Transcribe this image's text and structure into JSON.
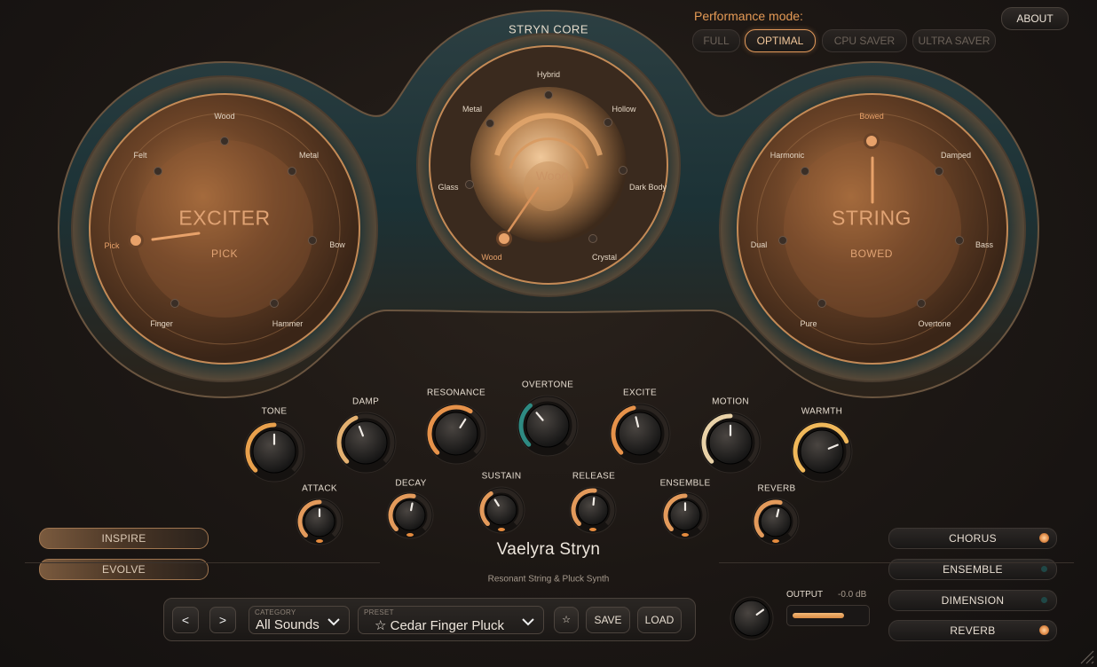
{
  "header": {
    "core_title": "STRYN CORE",
    "performance_label": "Performance mode:",
    "modes": [
      "FULL",
      "OPTIMAL",
      "CPU SAVER",
      "ULTRA SAVER"
    ],
    "active_mode": "OPTIMAL",
    "about_label": "ABOUT"
  },
  "exciter": {
    "title": "EXCITER",
    "value": "PICK",
    "options": [
      "Wood",
      "Metal",
      "Bow",
      "Hammer",
      "Finger",
      "Pick",
      "Felt"
    ],
    "selected": "Pick"
  },
  "core": {
    "options": [
      "Hybrid",
      "Hollow",
      "Dark Body",
      "Crystal",
      "Wood",
      "Glass",
      "Metal"
    ],
    "selected": "Wood",
    "center_text": "Wood"
  },
  "string": {
    "title": "STRING",
    "value": "BOWED",
    "options": [
      "Bowed",
      "Damped",
      "Bass",
      "Overtone",
      "Pure",
      "Dual",
      "Harmonic"
    ],
    "selected": "Bowed"
  },
  "knobs_main": [
    {
      "label": "TONE",
      "value": 0.5,
      "accent": "#e8a04c"
    },
    {
      "label": "DAMP",
      "value": 0.42,
      "accent": "#e3b070"
    },
    {
      "label": "RESONANCE",
      "value": 0.62,
      "accent": "#e6924a"
    },
    {
      "label": "OVERTONE",
      "value": 0.35,
      "accent": "#2e8a82"
    },
    {
      "label": "EXCITE",
      "value": 0.45,
      "accent": "#e6924a"
    },
    {
      "label": "MOTION",
      "value": 0.5,
      "accent": "#e9d2a8"
    },
    {
      "label": "WARMTH",
      "value": 0.75,
      "accent": "#f0b85a"
    }
  ],
  "knobs_small": [
    {
      "label": "ATTACK",
      "value": 0.5
    },
    {
      "label": "DECAY",
      "value": 0.54
    },
    {
      "label": "SUSTAIN",
      "value": 0.38
    },
    {
      "label": "RELEASE",
      "value": 0.52
    },
    {
      "label": "ENSEMBLE",
      "value": 0.5
    },
    {
      "label": "REVERB",
      "value": 0.55
    }
  ],
  "left_buttons": [
    "INSPIRE",
    "EVOLVE"
  ],
  "effects": [
    {
      "label": "CHORUS",
      "on": true
    },
    {
      "label": "ENSEMBLE",
      "on": false
    },
    {
      "label": "DIMENSION",
      "on": false
    },
    {
      "label": "REVERB",
      "on": true
    }
  ],
  "product": {
    "name": "Vaelyra Stryn",
    "tagline": "Resonant String & Pluck Synth"
  },
  "preset_bar": {
    "prev_label": "<",
    "next_label": ">",
    "category_caption": "CATEGORY",
    "category_value": "All Sounds",
    "preset_caption": "PRESET",
    "preset_value": "☆ Cedar Finger Pluck",
    "favorite_label": "☆",
    "save_label": "SAVE",
    "load_label": "LOAD"
  },
  "output": {
    "label": "OUTPUT",
    "db": "-0.0 dB",
    "level": 0.72,
    "knob_value": 0.7
  },
  "colors": {
    "accent": "#e39a5b",
    "teal": "#1f4f52",
    "bronze": "#c98a52"
  },
  "icons": [
    "chevron-down-icon",
    "star-icon",
    "resize-grip-icon"
  ]
}
